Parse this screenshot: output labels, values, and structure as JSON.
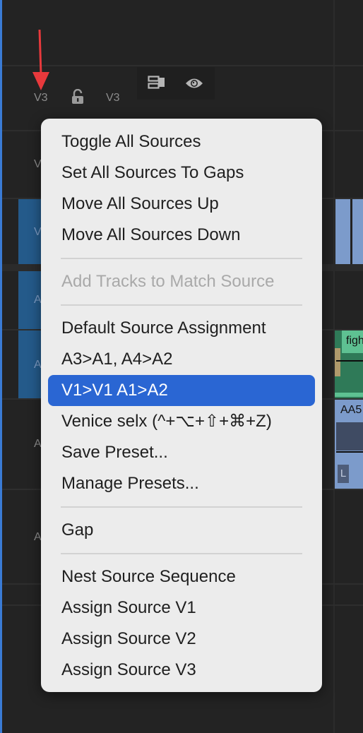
{
  "track_header": {
    "source_label": "V3",
    "target_label": "V3",
    "lock_icon": "unlock-icon",
    "sync_icon": "sync-lock-icon",
    "eye_icon": "eye-icon"
  },
  "tracks": {
    "v2_label": "V",
    "v1_label": "V",
    "a1_label": "A",
    "a2_label": "A",
    "a3_label": "A",
    "a4_label": "A"
  },
  "clips": {
    "green_clip_name": "figh",
    "audio_clip_name": "AA5",
    "audio_channel_badge": "L"
  },
  "annotation": {
    "arrow_color": "#e8393c"
  },
  "menu": {
    "groups": [
      {
        "items": [
          {
            "label": "Toggle All Sources",
            "state": "normal"
          },
          {
            "label": "Set All Sources To Gaps",
            "state": "normal"
          },
          {
            "label": "Move All Sources Up",
            "state": "normal"
          },
          {
            "label": "Move All Sources Down",
            "state": "normal"
          }
        ]
      },
      {
        "items": [
          {
            "label": "Add Tracks to Match Source",
            "state": "disabled"
          }
        ]
      },
      {
        "items": [
          {
            "label": "Default Source Assignment",
            "state": "normal"
          },
          {
            "label": "A3>A1, A4>A2",
            "state": "normal"
          },
          {
            "label": "V1>V1 A1>A2",
            "state": "selected"
          },
          {
            "label": "Venice selx (^+⌥+⇧+⌘+Z)",
            "state": "normal"
          },
          {
            "label": "Save Preset...",
            "state": "normal"
          },
          {
            "label": "Manage Presets...",
            "state": "normal"
          }
        ]
      },
      {
        "items": [
          {
            "label": "Gap",
            "state": "normal"
          }
        ]
      },
      {
        "items": [
          {
            "label": "Nest Source Sequence",
            "state": "normal"
          },
          {
            "label": "Assign Source V1",
            "state": "normal"
          },
          {
            "label": "Assign Source V2",
            "state": "normal"
          },
          {
            "label": "Assign Source V3",
            "state": "normal"
          }
        ]
      }
    ],
    "highlight_color": "#2a66d3"
  }
}
